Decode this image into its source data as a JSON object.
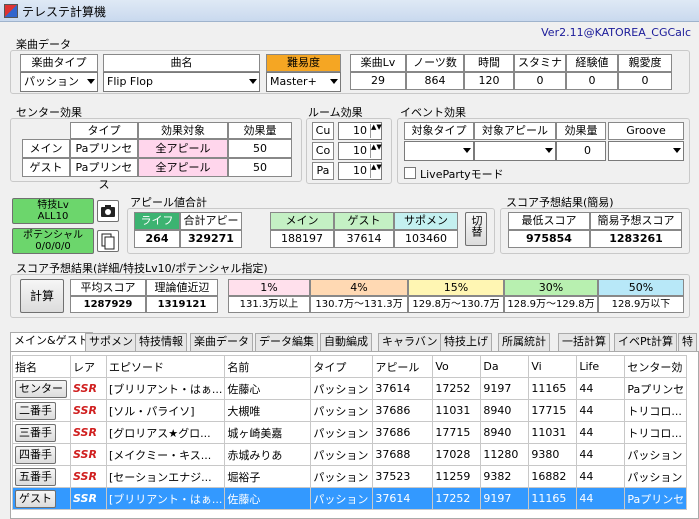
{
  "window": {
    "title": "テレステ計算機",
    "version": "Ver2.11@KATOREA_CGCalc"
  },
  "song": {
    "section": "楽曲データ",
    "type_label": "楽曲タイプ",
    "type_value": "パッション",
    "name_label": "曲名",
    "name_value": "Flip Flop",
    "difficulty_label": "難易度",
    "difficulty_value": "Master+",
    "stats_headers": [
      "楽曲Lv",
      "ノーツ数",
      "時間",
      "スタミナ",
      "経験値",
      "親愛度"
    ],
    "stats_values": [
      "29",
      "864",
      "120",
      "0",
      "0",
      "0"
    ]
  },
  "center": {
    "section": "センター効果",
    "headers": [
      "タイプ",
      "効果対象",
      "効果量"
    ],
    "rows": [
      {
        "label": "メイン",
        "type": "Paプリンセス",
        "target": "全アピール",
        "amount": "50"
      },
      {
        "label": "ゲスト",
        "type": "Paプリンセス",
        "target": "全アピール",
        "amount": "50"
      }
    ]
  },
  "room": {
    "section": "ルーム効果",
    "rows": [
      {
        "label": "Cu",
        "value": "10"
      },
      {
        "label": "Co",
        "value": "10"
      },
      {
        "label": "Pa",
        "value": "10"
      }
    ]
  },
  "event": {
    "section": "イベント効果",
    "headers": [
      "対象タイプ",
      "対象アピール",
      "効果量",
      "Groove"
    ],
    "amount": "0",
    "liveparty_label": "LivePartyモード"
  },
  "skill_button": {
    "line1": "特技Lv",
    "line2": "ALL10"
  },
  "potential_button": {
    "line1": "ポテンシャル",
    "line2": "0/0/0/0"
  },
  "appeal": {
    "section": "アピール値合計",
    "headers": [
      "ライフ",
      "合計アピール",
      "メイン",
      "ゲスト",
      "サポメン"
    ],
    "values": [
      "264",
      "329271",
      "188197",
      "37614",
      "103460"
    ],
    "swap_label": "切替"
  },
  "simple": {
    "section": "スコア予想結果(簡易)",
    "headers": [
      "最低スコア",
      "簡易予想スコア"
    ],
    "values": [
      "975854",
      "1283261"
    ]
  },
  "detail": {
    "section": "スコア予想結果(詳細/特技Lv10/ポテンシャル指定)",
    "calc_label": "計算",
    "headers": [
      "平均スコア",
      "理論値近辺",
      "1%",
      "4%",
      "15%",
      "30%",
      "50%"
    ],
    "values": [
      "1287929",
      "1319121",
      "131.3万以上",
      "130.7万～131.3万",
      "129.8万～130.7万",
      "128.9万～129.8万",
      "128.9万以下"
    ]
  },
  "tabs": [
    "メイン&ゲスト",
    "サポメン",
    "特技情報",
    "楽曲データ",
    "データ編集",
    "自動編成",
    "キャラバン",
    "特技上げ",
    "所属統計",
    "一括計算",
    "イベPt計算",
    "特"
  ],
  "table": {
    "headers": [
      "指名",
      "レア",
      "エピソード",
      "名前",
      "タイプ",
      "アピール",
      "Vo",
      "Da",
      "Vi",
      "Life",
      "センター効"
    ],
    "rows": [
      {
        "slot": "センター",
        "rare": "SSR",
        "episode": "[ブリリアント・はぁ...",
        "name": "佐藤心",
        "type": "パッション",
        "appeal": "37614",
        "vo": "17252",
        "da": "9197",
        "vi": "11165",
        "life": "44",
        "center": "Paプリンセ"
      },
      {
        "slot": "二番手",
        "rare": "SSR",
        "episode": "[ソル・パライソ]",
        "name": "大槻唯",
        "type": "パッション",
        "appeal": "37686",
        "vo": "11031",
        "da": "8940",
        "vi": "17715",
        "life": "44",
        "center": "トリコロ..."
      },
      {
        "slot": "三番手",
        "rare": "SSR",
        "episode": "[グロリアス★グロ...",
        "name": "城ヶ崎美嘉",
        "type": "パッション",
        "appeal": "37686",
        "vo": "17715",
        "da": "8940",
        "vi": "11031",
        "life": "44",
        "center": "トリコロ..."
      },
      {
        "slot": "四番手",
        "rare": "SSR",
        "episode": "[メイクミー・キス...",
        "name": "赤城みりあ",
        "type": "パッション",
        "appeal": "37688",
        "vo": "17028",
        "da": "11280",
        "vi": "9380",
        "life": "44",
        "center": "パッション"
      },
      {
        "slot": "五番手",
        "rare": "SSR",
        "episode": "[セーションエナジ...",
        "name": "堀裕子",
        "type": "パッション",
        "appeal": "37523",
        "vo": "11259",
        "da": "9382",
        "vi": "16882",
        "life": "44",
        "center": "パッション"
      },
      {
        "slot": "ゲスト",
        "rare": "SSR",
        "episode": "[ブリリアント・はぁ...",
        "name": "佐藤心",
        "type": "パッション",
        "appeal": "37614",
        "vo": "17252",
        "da": "9197",
        "vi": "11165",
        "life": "44",
        "center": "Paプリンセ"
      }
    ]
  },
  "colors": {
    "difficulty": "#f5a623",
    "life": "#3cb371",
    "pink": "#ffd6ec",
    "green_btn": "#6cd66c",
    "selected_row": "#3399ff"
  }
}
